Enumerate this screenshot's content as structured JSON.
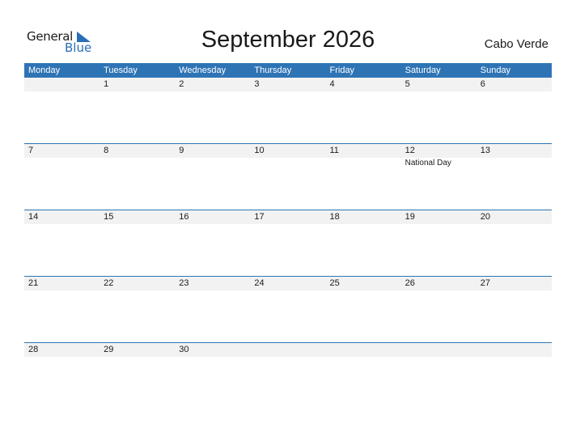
{
  "logo": {
    "general": "General",
    "blue": "Blue"
  },
  "title": "September 2026",
  "country": "Cabo Verde",
  "accent_color": "#2e74b5",
  "weekdays": [
    "Monday",
    "Tuesday",
    "Wednesday",
    "Thursday",
    "Friday",
    "Saturday",
    "Sunday"
  ],
  "weeks": [
    {
      "days": [
        "",
        "1",
        "2",
        "3",
        "4",
        "5",
        "6"
      ],
      "events": [
        "",
        "",
        "",
        "",
        "",
        "",
        ""
      ]
    },
    {
      "days": [
        "7",
        "8",
        "9",
        "10",
        "11",
        "12",
        "13"
      ],
      "events": [
        "",
        "",
        "",
        "",
        "",
        "National Day",
        ""
      ]
    },
    {
      "days": [
        "14",
        "15",
        "16",
        "17",
        "18",
        "19",
        "20"
      ],
      "events": [
        "",
        "",
        "",
        "",
        "",
        "",
        ""
      ]
    },
    {
      "days": [
        "21",
        "22",
        "23",
        "24",
        "25",
        "26",
        "27"
      ],
      "events": [
        "",
        "",
        "",
        "",
        "",
        "",
        ""
      ]
    },
    {
      "days": [
        "28",
        "29",
        "30",
        "",
        "",
        "",
        ""
      ],
      "events": [
        "",
        "",
        "",
        "",
        "",
        "",
        ""
      ]
    }
  ]
}
